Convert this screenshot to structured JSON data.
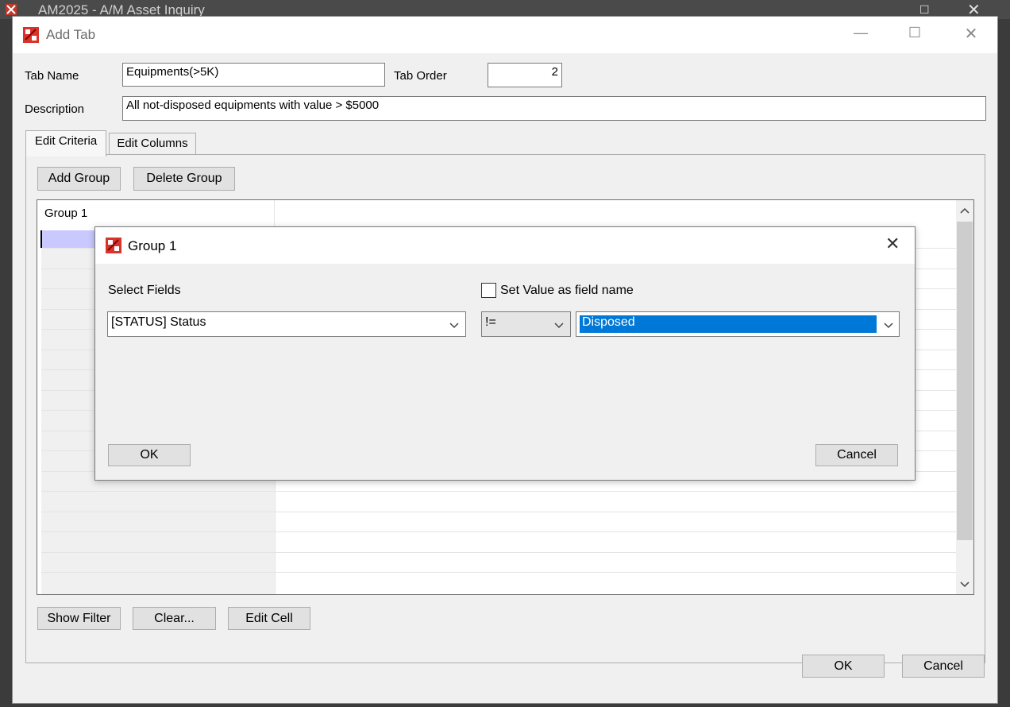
{
  "background_window": {
    "title": "AM2025 - A/M Asset Inquiry"
  },
  "add_tab_window": {
    "title": "Add Tab",
    "tab_name_label": "Tab Name",
    "tab_name_value": "Equipments(>5K)",
    "tab_order_label": "Tab Order",
    "tab_order_value": "2",
    "description_label": "Description",
    "description_value": "All not-disposed equipments with value > $5000",
    "tabs": [
      {
        "label": "Edit Criteria"
      },
      {
        "label": "Edit Columns"
      }
    ],
    "add_group_label": "Add Group",
    "delete_group_label": "Delete Group",
    "grid": {
      "group_header": "Group 1"
    },
    "show_filter_label": "Show Filter",
    "clear_label": "Clear...",
    "edit_cell_label": "Edit Cell",
    "ok_label": "OK",
    "cancel_label": "Cancel"
  },
  "group_dialog": {
    "title": "Group 1",
    "select_fields_label": "Select Fields",
    "field_value": "[STATUS] Status",
    "set_value_checkbox_label": "Set Value as field name",
    "set_value_checked": false,
    "operator_value": "!=",
    "value_value": "Disposed",
    "ok_label": "OK",
    "cancel_label": "Cancel"
  },
  "colors": {
    "selection": "#0078d7",
    "active_cell": "#c9c9ff"
  }
}
